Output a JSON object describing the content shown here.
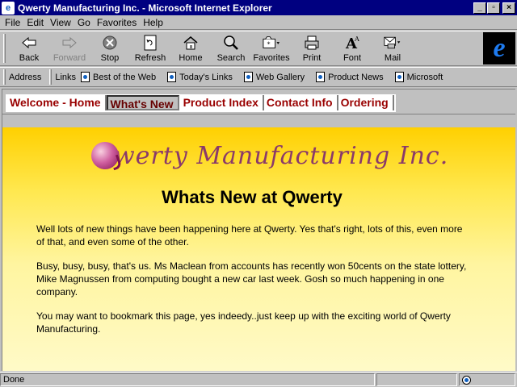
{
  "window": {
    "title": "Qwerty Manufacturing Inc. - Microsoft Internet Explorer",
    "icon": "ie-page-icon"
  },
  "menu": [
    "File",
    "Edit",
    "View",
    "Go",
    "Favorites",
    "Help"
  ],
  "toolbar": {
    "back": "Back",
    "forward": "Forward",
    "stop": "Stop",
    "refresh": "Refresh",
    "home": "Home",
    "search": "Search",
    "favorites": "Favorites",
    "print": "Print",
    "font": "Font",
    "mail": "Mail"
  },
  "linksbar": {
    "address_label": "Address",
    "links_label": "Links",
    "links": [
      "Best of the Web",
      "Today's Links",
      "Web Gallery",
      "Product News",
      "Microsoft"
    ]
  },
  "site_nav": {
    "tabs": [
      "Welcome - Home",
      "What's New",
      "Product Index",
      "Contact Info",
      "Ordering"
    ],
    "active": "What's New"
  },
  "page": {
    "logo_text": "Qwerty Manufacturing Inc.",
    "logo_initial": "Q",
    "logo_rest": "werty Manufacturing Inc.",
    "heading": "Whats New at Qwerty",
    "paragraphs": [
      "Well lots of new things have been happening here at Qwerty. Yes that's right, lots of this, even more of that, and even some of the other.",
      "Busy, busy, busy, that's us. Ms Maclean from accounts has recently won 50cents on the state lottery, Mike Magnussen from computing bought a new car last week. Gosh so much happening in one company.",
      "You may want to bookmark this page, yes indeedy..just keep up with the exciting world of Qwerty Manufacturing."
    ],
    "background_colors": [
      "#ffd000",
      "#fffac8"
    ],
    "logo_color": "#8a3a6a"
  },
  "status": {
    "text": "Done",
    "zone_icon": "globe-icon"
  }
}
